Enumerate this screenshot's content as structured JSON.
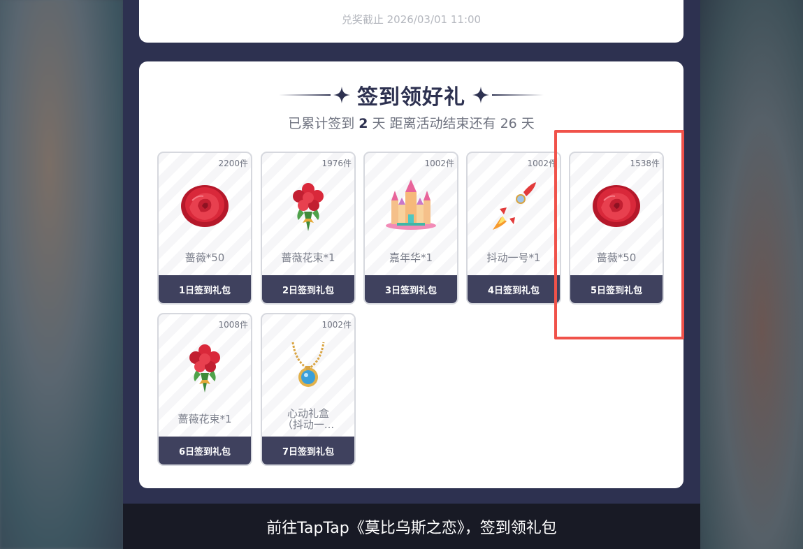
{
  "top_card": {
    "deadline": "兑奖截止 2026/03/01 11:00"
  },
  "main": {
    "title": "签到领好礼",
    "subtitle": {
      "prefix": "已累计签到 ",
      "days": "2",
      "suffix": " 天  距离活动结束还有 26 天"
    },
    "rewards": [
      {
        "count": "2200件",
        "name": "蔷薇*50",
        "label": "1日签到礼包",
        "icon": "rose-icon"
      },
      {
        "count": "1976件",
        "name": "蔷薇花束*1",
        "label": "2日签到礼包",
        "icon": "bouquet-icon"
      },
      {
        "count": "1002件",
        "name": "嘉年华*1",
        "label": "3日签到礼包",
        "icon": "castle-icon"
      },
      {
        "count": "1002件",
        "name": "抖动一号*1",
        "label": "4日签到礼包",
        "icon": "rocket-icon"
      },
      {
        "count": "1538件",
        "name": "蔷薇*50",
        "label": "5日签到礼包",
        "icon": "rose-icon"
      },
      {
        "count": "1008件",
        "name": "蔷薇花束*1",
        "label": "6日签到礼包",
        "icon": "bouquet-icon"
      },
      {
        "count": "1002件",
        "name": "心动礼盒\n（抖动一...",
        "label": "7日签到礼包",
        "icon": "necklace-icon"
      }
    ]
  },
  "bottom_bar": {
    "text": "前往TapTap《莫比乌斯之恋》，签到领礼包"
  },
  "colors": {
    "panel": "#2d3150",
    "card_footer": "#3f415e",
    "highlight": "#f0524a"
  }
}
